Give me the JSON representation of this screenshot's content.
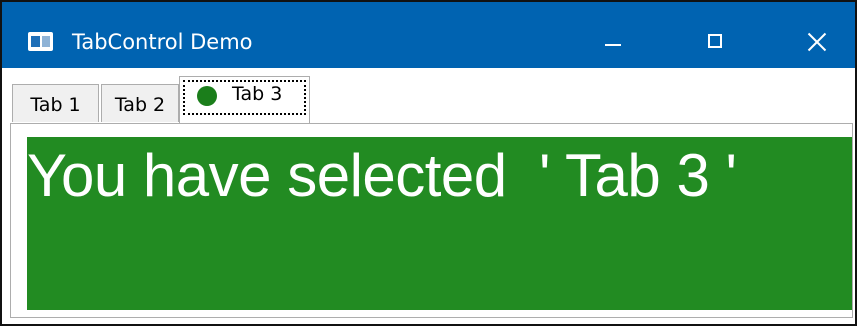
{
  "window": {
    "title": "TabControl Demo",
    "app_icon": "app-window-icon",
    "controls": {
      "minimize_icon": "minimize-icon",
      "maximize_icon": "maximize-icon",
      "close_icon": "close-icon"
    },
    "titlebar_color": "#0063b1"
  },
  "tabs": [
    {
      "label": "Tab 1",
      "selected": false
    },
    {
      "label": "Tab 2",
      "selected": false
    },
    {
      "label": "Tab 3",
      "selected": true,
      "icon": "green-circle-icon",
      "icon_color": "#1b7e1b"
    }
  ],
  "content": {
    "message": "You have selected  ' Tab 3 '",
    "background_color": "#228b22",
    "text_color": "#ffffff"
  }
}
